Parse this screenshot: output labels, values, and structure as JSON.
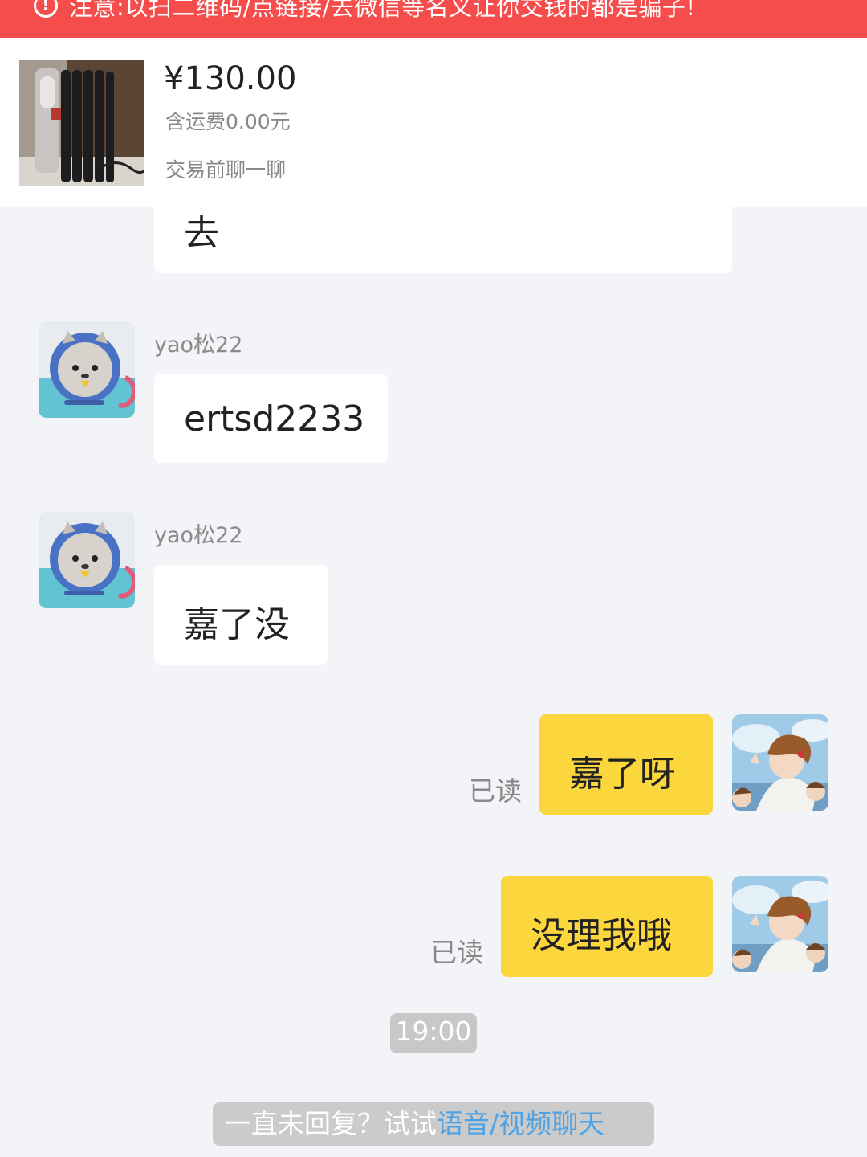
{
  "warning_bar": {
    "icon": "exclamation-circle-icon",
    "text": "注意:以扫二维码/点链接/去微信等名义让你交钱的都是骗子!"
  },
  "product": {
    "price": "¥130.00",
    "shipping": "含运费0.00元",
    "chat_hint": "交易前聊一聊"
  },
  "messages": [
    {
      "side": "other",
      "text": "去"
    },
    {
      "side": "other",
      "username": "yao松22",
      "text": "ertsd2233"
    },
    {
      "side": "other",
      "username": "yao松22",
      "text": "嘉了没"
    },
    {
      "side": "me",
      "text": "嘉了呀",
      "status": "已读"
    },
    {
      "side": "me",
      "text": "没理我哦",
      "status": "已读"
    }
  ],
  "timestamp": "19:00",
  "tip": {
    "prefix": "一直未回复？试试",
    "link": "语音/视频聊天"
  },
  "colors": {
    "warning_bg": "#f54c4c",
    "my_bubble": "#fcd63d",
    "background": "#f3f4f7",
    "link": "#4ea3e6"
  }
}
